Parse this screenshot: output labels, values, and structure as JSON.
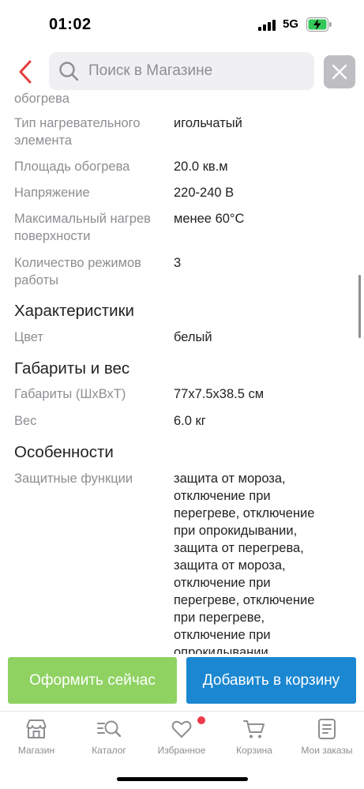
{
  "status": {
    "time": "01:02",
    "network": "5G"
  },
  "search": {
    "placeholder": "Поиск в Магазине"
  },
  "specs": [
    {
      "label": "обогрева",
      "value": ""
    },
    {
      "label": "Тип нагревательного элемента",
      "value": "игольчатый"
    },
    {
      "label": "Площадь обогрева",
      "value": "20.0 кв.м"
    },
    {
      "label": "Напряжение",
      "value": "220-240 В"
    },
    {
      "label": "Максимальный нагрев поверхности",
      "value": "менее 60°C"
    },
    {
      "label": "Количество режимов работы",
      "value": "3"
    }
  ],
  "section_characteristics": {
    "title": "Характеристики",
    "rows": [
      {
        "label": "Цвет",
        "value": "белый"
      }
    ]
  },
  "section_dimensions": {
    "title": "Габариты и вес",
    "rows": [
      {
        "label": "Габариты (ШхВхТ)",
        "value": "77x7.5x38.5 см"
      },
      {
        "label": "Вес",
        "value": "6.0 кг"
      }
    ]
  },
  "section_features": {
    "title": "Особенности",
    "rows": [
      {
        "label": "Защитные функции",
        "value": "защита от мороза, отключение при перегреве, отключение при опрокидывании, защита от перегрева, защита от мороза, отключение при перегреве, отключение при перегреве, отключение при опрокидывании"
      }
    ]
  },
  "buttons": {
    "order_now": "Оформить сейчас",
    "add_to_cart": "Добавить в корзину"
  },
  "tabs": [
    {
      "label": "Магазин",
      "icon": "store-icon"
    },
    {
      "label": "Каталог",
      "icon": "catalog-search-icon"
    },
    {
      "label": "Избранное",
      "icon": "heart-icon"
    },
    {
      "label": "Корзина",
      "icon": "cart-icon"
    },
    {
      "label": "Мои заказы",
      "icon": "orders-icon"
    }
  ],
  "colors": {
    "accent_red": "#e63c3c",
    "order_green": "#8fd262",
    "cart_blue": "#1b87d1",
    "badge_red": "#ee3a4b"
  }
}
